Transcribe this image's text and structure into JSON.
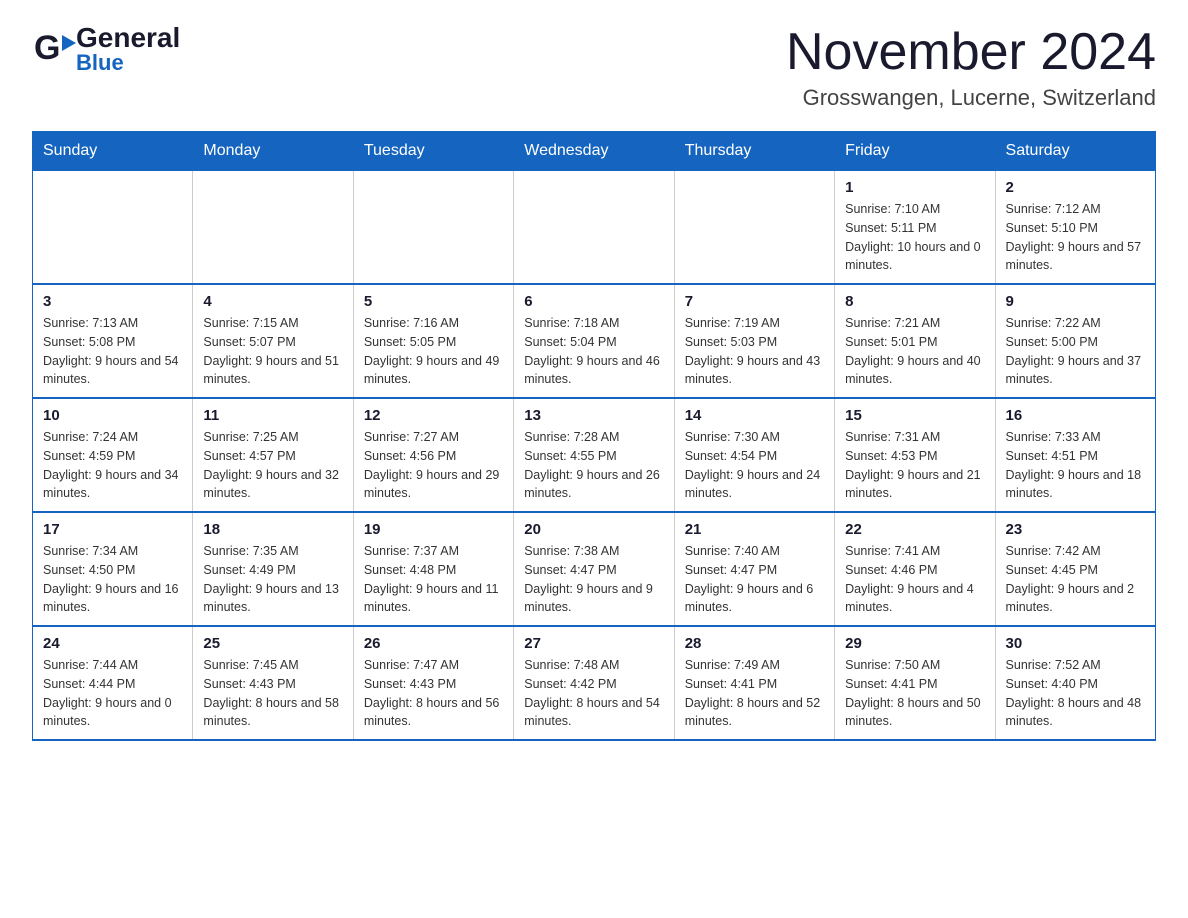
{
  "logo": {
    "text_general": "General",
    "text_blue": "Blue",
    "icon": "▶"
  },
  "title": {
    "month_year": "November 2024",
    "location": "Grosswangen, Lucerne, Switzerland"
  },
  "weekdays": [
    "Sunday",
    "Monday",
    "Tuesday",
    "Wednesday",
    "Thursday",
    "Friday",
    "Saturday"
  ],
  "weeks": [
    [
      {
        "day": "",
        "info": ""
      },
      {
        "day": "",
        "info": ""
      },
      {
        "day": "",
        "info": ""
      },
      {
        "day": "",
        "info": ""
      },
      {
        "day": "",
        "info": ""
      },
      {
        "day": "1",
        "info": "Sunrise: 7:10 AM\nSunset: 5:11 PM\nDaylight: 10 hours and 0 minutes."
      },
      {
        "day": "2",
        "info": "Sunrise: 7:12 AM\nSunset: 5:10 PM\nDaylight: 9 hours and 57 minutes."
      }
    ],
    [
      {
        "day": "3",
        "info": "Sunrise: 7:13 AM\nSunset: 5:08 PM\nDaylight: 9 hours and 54 minutes."
      },
      {
        "day": "4",
        "info": "Sunrise: 7:15 AM\nSunset: 5:07 PM\nDaylight: 9 hours and 51 minutes."
      },
      {
        "day": "5",
        "info": "Sunrise: 7:16 AM\nSunset: 5:05 PM\nDaylight: 9 hours and 49 minutes."
      },
      {
        "day": "6",
        "info": "Sunrise: 7:18 AM\nSunset: 5:04 PM\nDaylight: 9 hours and 46 minutes."
      },
      {
        "day": "7",
        "info": "Sunrise: 7:19 AM\nSunset: 5:03 PM\nDaylight: 9 hours and 43 minutes."
      },
      {
        "day": "8",
        "info": "Sunrise: 7:21 AM\nSunset: 5:01 PM\nDaylight: 9 hours and 40 minutes."
      },
      {
        "day": "9",
        "info": "Sunrise: 7:22 AM\nSunset: 5:00 PM\nDaylight: 9 hours and 37 minutes."
      }
    ],
    [
      {
        "day": "10",
        "info": "Sunrise: 7:24 AM\nSunset: 4:59 PM\nDaylight: 9 hours and 34 minutes."
      },
      {
        "day": "11",
        "info": "Sunrise: 7:25 AM\nSunset: 4:57 PM\nDaylight: 9 hours and 32 minutes."
      },
      {
        "day": "12",
        "info": "Sunrise: 7:27 AM\nSunset: 4:56 PM\nDaylight: 9 hours and 29 minutes."
      },
      {
        "day": "13",
        "info": "Sunrise: 7:28 AM\nSunset: 4:55 PM\nDaylight: 9 hours and 26 minutes."
      },
      {
        "day": "14",
        "info": "Sunrise: 7:30 AM\nSunset: 4:54 PM\nDaylight: 9 hours and 24 minutes."
      },
      {
        "day": "15",
        "info": "Sunrise: 7:31 AM\nSunset: 4:53 PM\nDaylight: 9 hours and 21 minutes."
      },
      {
        "day": "16",
        "info": "Sunrise: 7:33 AM\nSunset: 4:51 PM\nDaylight: 9 hours and 18 minutes."
      }
    ],
    [
      {
        "day": "17",
        "info": "Sunrise: 7:34 AM\nSunset: 4:50 PM\nDaylight: 9 hours and 16 minutes."
      },
      {
        "day": "18",
        "info": "Sunrise: 7:35 AM\nSunset: 4:49 PM\nDaylight: 9 hours and 13 minutes."
      },
      {
        "day": "19",
        "info": "Sunrise: 7:37 AM\nSunset: 4:48 PM\nDaylight: 9 hours and 11 minutes."
      },
      {
        "day": "20",
        "info": "Sunrise: 7:38 AM\nSunset: 4:47 PM\nDaylight: 9 hours and 9 minutes."
      },
      {
        "day": "21",
        "info": "Sunrise: 7:40 AM\nSunset: 4:47 PM\nDaylight: 9 hours and 6 minutes."
      },
      {
        "day": "22",
        "info": "Sunrise: 7:41 AM\nSunset: 4:46 PM\nDaylight: 9 hours and 4 minutes."
      },
      {
        "day": "23",
        "info": "Sunrise: 7:42 AM\nSunset: 4:45 PM\nDaylight: 9 hours and 2 minutes."
      }
    ],
    [
      {
        "day": "24",
        "info": "Sunrise: 7:44 AM\nSunset: 4:44 PM\nDaylight: 9 hours and 0 minutes."
      },
      {
        "day": "25",
        "info": "Sunrise: 7:45 AM\nSunset: 4:43 PM\nDaylight: 8 hours and 58 minutes."
      },
      {
        "day": "26",
        "info": "Sunrise: 7:47 AM\nSunset: 4:43 PM\nDaylight: 8 hours and 56 minutes."
      },
      {
        "day": "27",
        "info": "Sunrise: 7:48 AM\nSunset: 4:42 PM\nDaylight: 8 hours and 54 minutes."
      },
      {
        "day": "28",
        "info": "Sunrise: 7:49 AM\nSunset: 4:41 PM\nDaylight: 8 hours and 52 minutes."
      },
      {
        "day": "29",
        "info": "Sunrise: 7:50 AM\nSunset: 4:41 PM\nDaylight: 8 hours and 50 minutes."
      },
      {
        "day": "30",
        "info": "Sunrise: 7:52 AM\nSunset: 4:40 PM\nDaylight: 8 hours and 48 minutes."
      }
    ]
  ]
}
